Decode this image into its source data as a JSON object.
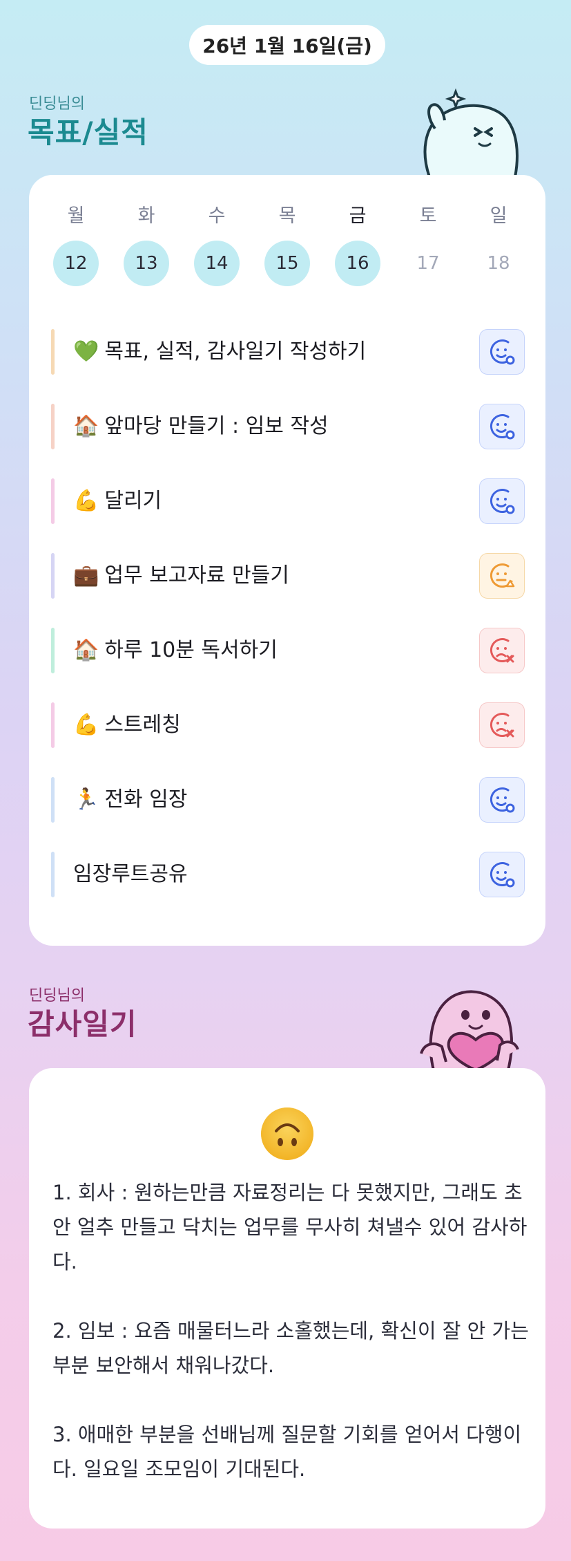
{
  "header": {
    "date": "26년 1월 16일(금)"
  },
  "goals_section": {
    "owner_label": "딘딩님의",
    "title": "목표/실적"
  },
  "week": {
    "days": [
      {
        "label": "월",
        "date": "12",
        "state": "filled"
      },
      {
        "label": "화",
        "date": "13",
        "state": "filled"
      },
      {
        "label": "수",
        "date": "14",
        "state": "filled"
      },
      {
        "label": "목",
        "date": "15",
        "state": "filled"
      },
      {
        "label": "금",
        "date": "16",
        "state": "filled"
      },
      {
        "label": "토",
        "date": "17",
        "state": "empty"
      },
      {
        "label": "일",
        "date": "18",
        "state": "empty"
      }
    ]
  },
  "goals": [
    {
      "emoji": "💚",
      "text": "목표, 실적, 감사일기 작성하기",
      "status": "done",
      "bar_color": "#f6d9b4",
      "icon": "smile-check-icon"
    },
    {
      "emoji": "🏠",
      "text": "앞마당 만들기 : 임보 작성",
      "status": "done",
      "bar_color": "#f6d2c6",
      "icon": "smile-check-icon"
    },
    {
      "emoji": "💪",
      "text": "달리기",
      "status": "done",
      "bar_color": "#f4cbe6",
      "icon": "smile-check-icon"
    },
    {
      "emoji": "💼",
      "text": "업무 보고자료 만들기",
      "status": "partial",
      "bar_color": "#d6d5f4",
      "icon": "neutral-triangle-icon"
    },
    {
      "emoji": "🏠",
      "text": "하루 10분 독서하기",
      "status": "fail",
      "bar_color": "#bfeedc",
      "icon": "sad-x-icon"
    },
    {
      "emoji": "💪",
      "text": "스트레칭",
      "status": "fail",
      "bar_color": "#f4cbe6",
      "icon": "sad-x-icon"
    },
    {
      "emoji": "🏃",
      "text": "전화 임장",
      "status": "done",
      "bar_color": "#cfe0f6",
      "icon": "smile-check-icon"
    },
    {
      "emoji": "",
      "text": "임장루트공유",
      "status": "done",
      "bar_color": "#cfe0f6",
      "icon": "smile-check-icon"
    }
  ],
  "diary_section": {
    "owner_label": "딘딩님의",
    "title": "감사일기",
    "mood_icon": "upside-down-face-icon"
  },
  "diary": {
    "paragraphs": [
      "1. 회사 : 원하는만큼 자료정리는 다 못했지만, 그래도 초안 얼추 만들고 닥치는 업무를 무사히 쳐낼수 있어 감사하다.",
      "2. 임보 : 요즘 매물터느라 소홀했는데, 확신이 잘 안 가는 부분 보안해서 채워나갔다.",
      "3. 애매한 부분을 선배님께 질문할 기회를 얻어서 다행이다. 일요일 조모임이 기대된다."
    ]
  },
  "colors": {
    "done": "#3d63e0",
    "partial": "#ee9a34",
    "fail": "#e45a5a",
    "goals_title": "#1b8a90",
    "diary_title": "#8c2f6a",
    "day_highlight": "#c1ecf3"
  }
}
